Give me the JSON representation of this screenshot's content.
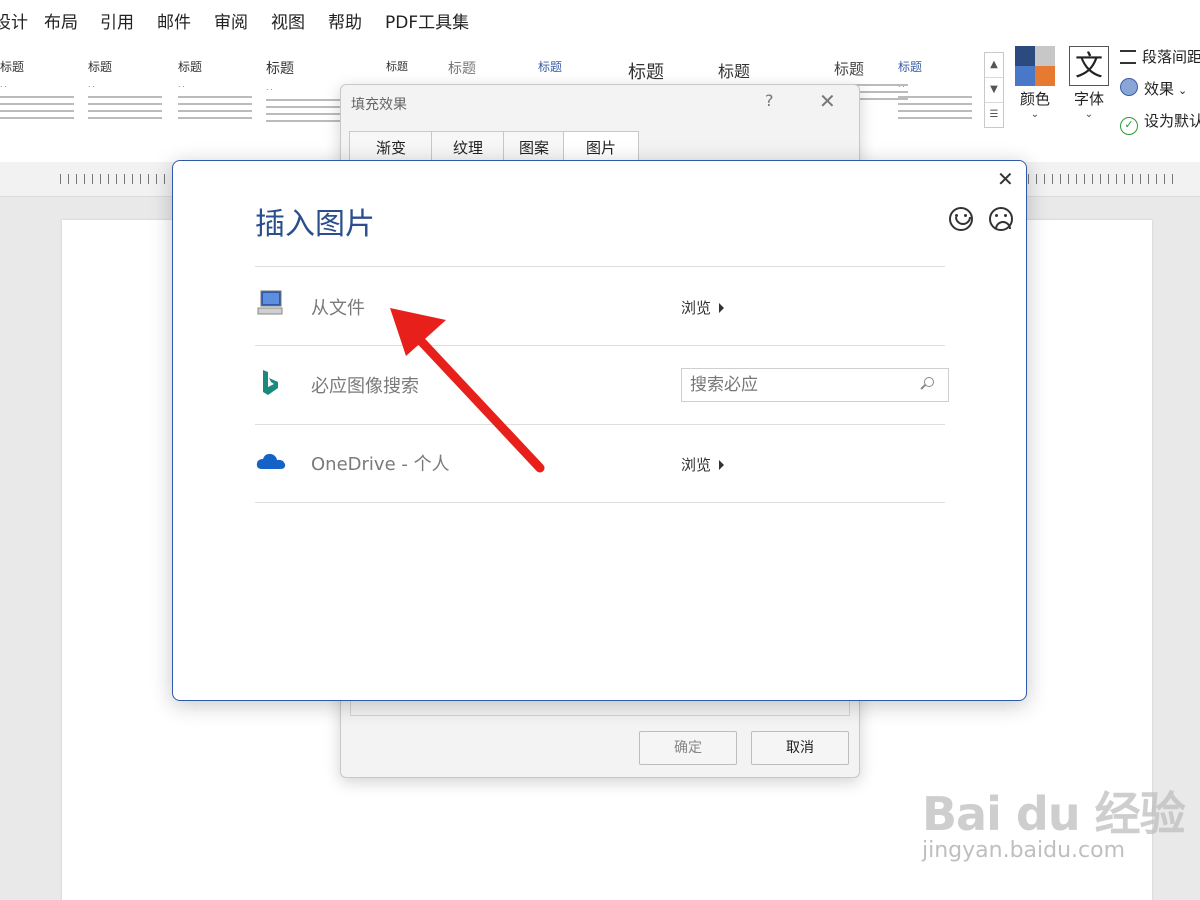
{
  "menu_tabs": [
    {
      "label": "设计",
      "active": true
    },
    {
      "label": "布局",
      "active": false
    },
    {
      "label": "引用",
      "active": false
    },
    {
      "label": "邮件",
      "active": false
    },
    {
      "label": "审阅",
      "active": false
    },
    {
      "label": "视图",
      "active": false
    },
    {
      "label": "帮助",
      "active": false
    },
    {
      "label": "PDF工具集",
      "active": false
    }
  ],
  "ribbon": {
    "styles": [
      "标题",
      "标题",
      "标题",
      "标题",
      "标题",
      "标题",
      "标题",
      "标题",
      "标题",
      "标题",
      "标题"
    ],
    "colors_label": "颜色",
    "fonts_label": "字体",
    "paragraph_spacing": "段落间距",
    "effects": "效果",
    "set_default": "设为默认值"
  },
  "fill_dialog": {
    "title": "填充效果",
    "help": "?",
    "tabs": [
      "渐变",
      "纹理",
      "图案",
      "图片"
    ],
    "active_tab": "图片",
    "ok": "确定",
    "cancel": "取消"
  },
  "insert_dialog": {
    "title": "插入图片",
    "rows": [
      {
        "label": "从文件",
        "action": "浏览",
        "icon": "computer-icon"
      },
      {
        "label": "必应图像搜索",
        "search_placeholder": "搜索必应",
        "icon": "bing-icon"
      },
      {
        "label": "OneDrive - 个人",
        "action": "浏览",
        "icon": "onedrive-icon"
      }
    ]
  },
  "watermark": {
    "brand": "Bai du 经验",
    "url": "jingyan.baidu.com"
  },
  "colors": {
    "accent": "#1b5fb0",
    "dialog_title": "#2b4f8c",
    "annotation_arrow": "#e8201c"
  }
}
